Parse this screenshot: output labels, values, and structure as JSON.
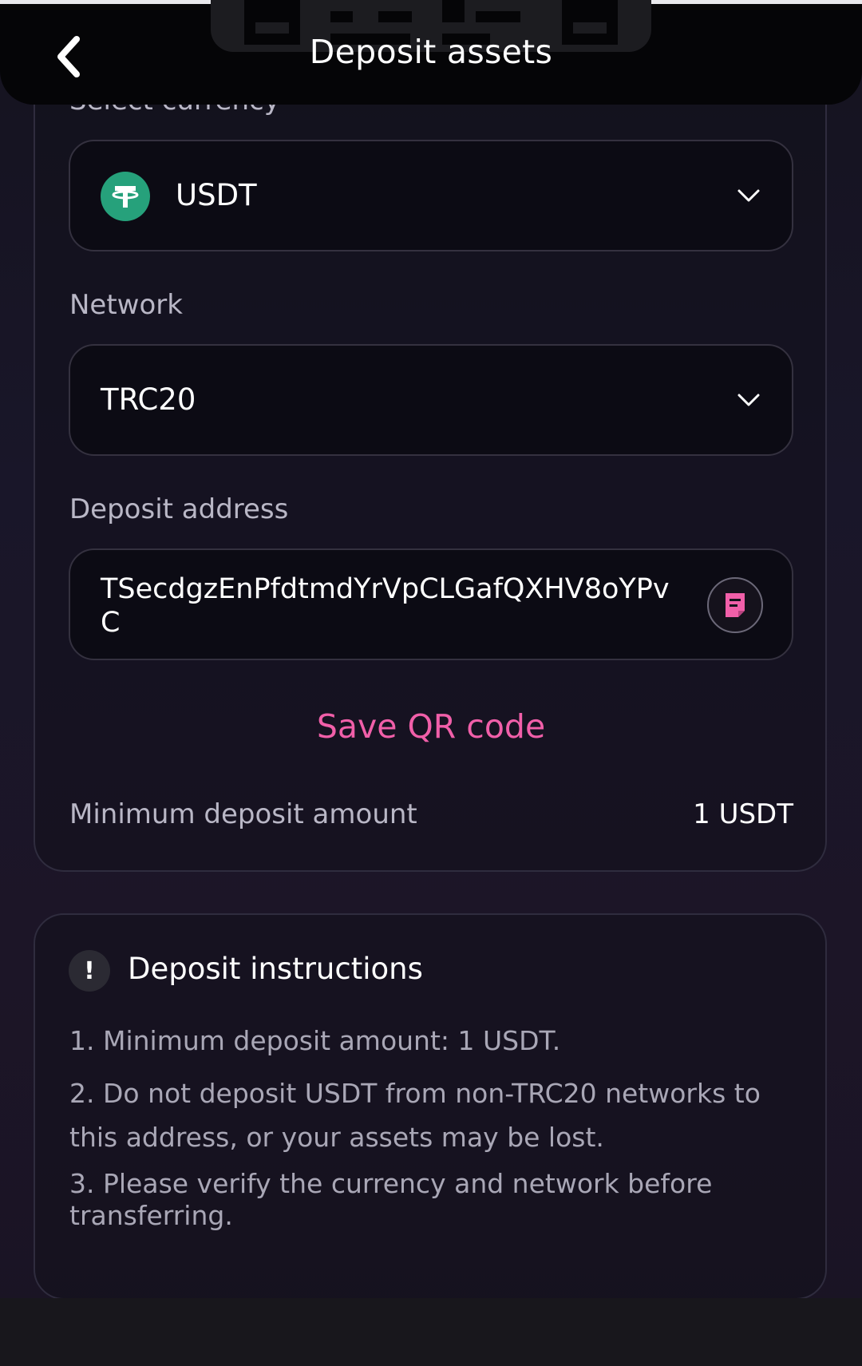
{
  "header": {
    "title": "Deposit assets"
  },
  "currency": {
    "label": "Select currency",
    "selected": "USDT"
  },
  "network": {
    "label": "Network",
    "selected": "TRC20"
  },
  "deposit_address": {
    "label": "Deposit address",
    "value": "TSecdgzEnPfdtmdYrVpCLGafQXHV8oYPvC"
  },
  "save_qr_label": "Save QR code",
  "minimum": {
    "label": "Minimum deposit amount",
    "value": "1 USDT"
  },
  "instructions": {
    "title": "Deposit instructions",
    "icon_glyph": "!",
    "items": [
      "1. Minimum deposit amount: 1 USDT.",
      "2. Do not deposit USDT from non-TRC20 networks to this address, or your assets may be lost.",
      "3. Please verify the currency and network before transferring."
    ]
  },
  "colors": {
    "accent": "#f15fa9",
    "tether_green": "#26a17b",
    "background": "#15131f"
  },
  "icons": {
    "back": "back-arrow-icon",
    "coin": "tether-usdt-icon",
    "dropdown": "chevron-down-icon",
    "copy": "copy-icon",
    "info": "exclamation-icon"
  }
}
